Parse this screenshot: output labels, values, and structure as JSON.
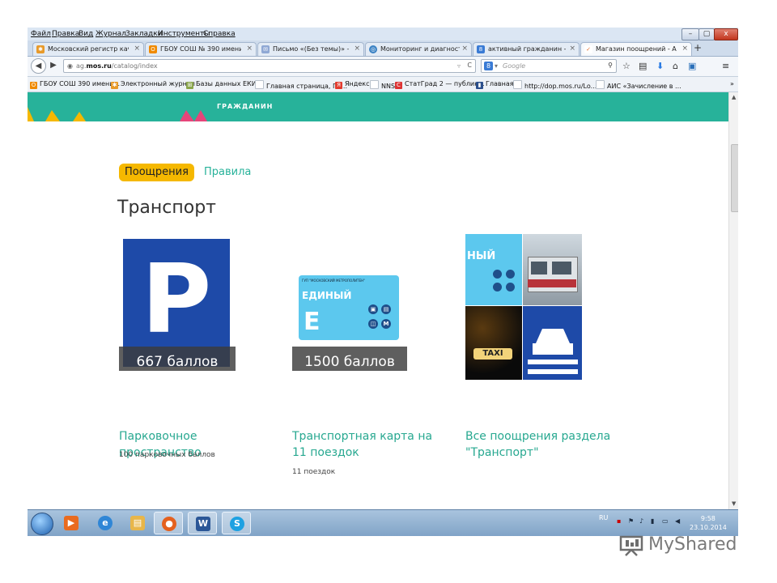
{
  "menu": [
    "Файл",
    "Правка",
    "Вид",
    "Журнал",
    "Закладки",
    "Инструменты",
    "Справка"
  ],
  "window_controls": {
    "minimize": "–",
    "maximize": "▢",
    "close": "x"
  },
  "tabs": [
    {
      "label": "Московский регистр каче...",
      "icon": "leaf-icon",
      "color": "#e89a2a"
    },
    {
      "label": "ГБОУ СОШ № 390 имени ...",
      "icon": "orange-o-icon",
      "color": "#f08a00"
    },
    {
      "label": "Письмо «(Без темы)» — Е...",
      "icon": "mail-icon",
      "color": "#6a8fc9"
    },
    {
      "label": "Мониторинг и диагностика",
      "icon": "globe-icon",
      "color": "#3b82c4"
    },
    {
      "label": "активный гражданин - По...",
      "icon": "google-icon",
      "color": "#3a7bd5"
    },
    {
      "label": "Магазин поощрений - Ак...",
      "icon": "ag-icon",
      "color": "#e46b2a"
    }
  ],
  "tab_close": "×",
  "new_tab": "+",
  "url": {
    "prefix": "ag.",
    "host": "mos.ru",
    "path": "/catalog/index"
  },
  "search": {
    "engine_label": "8",
    "placeholder": "Google"
  },
  "bookmarks": [
    {
      "label": "ГБОУ СОШ 390 имени...",
      "color": "#f08a00",
      "glyph": "О"
    },
    {
      "label": "Электронный журнал",
      "color": "#e89a2a",
      "glyph": "✱"
    },
    {
      "label": "Базы данных ЕКИС",
      "color": "#8aa64c",
      "glyph": "⊞"
    },
    {
      "label": "Главная страница, ГБ...",
      "color": "#b9c2cc",
      "glyph": ""
    },
    {
      "label": "Яндекс",
      "color": "#e23b2e",
      "glyph": "Я"
    },
    {
      "label": "NNS",
      "color": "#b9c2cc",
      "glyph": ""
    },
    {
      "label": "СтатГрад 2 — публик...",
      "color": "#d33",
      "glyph": "С"
    },
    {
      "label": "Главная",
      "color": "#2b4f8c",
      "glyph": "▮"
    },
    {
      "label": "http://dop.mos.ru/Lo...",
      "color": "#b9c2cc",
      "glyph": ""
    },
    {
      "label": "АИС «Зачисление в ...",
      "color": "#b9c2cc",
      "glyph": ""
    }
  ],
  "bookmarks_more": "»",
  "banner": {
    "text": "ГРАЖДАНИН"
  },
  "nav": {
    "active": "Поощрения",
    "other": "Правила"
  },
  "section_title": "Транспорт",
  "cards": [
    {
      "price": "667 баллов",
      "title": "Парковочное пространство",
      "subtitle": "100 парковочных баллов"
    },
    {
      "price": "1500 баллов",
      "title": "Транспортная карта на 11 поездок",
      "subtitle": "11 поездок"
    },
    {
      "price": "",
      "title": "Все поощрения раздела \"Транспорт\"",
      "subtitle": ""
    }
  ],
  "card_images": {
    "parking_letter": "P",
    "ticket_brand": "ГУП \"МОСКОВСКИЙ МЕТРОПОЛИТЕН\"",
    "ticket_name": "ЕДИНЫЙ",
    "ticket_letter": "E",
    "collage_word": "НЫЙ",
    "taxi_word": "TAXI"
  },
  "taskbar": {
    "apps": [
      {
        "name": "media-player-icon",
        "color": "#e96b1f",
        "glyph": "▶",
        "open": false
      },
      {
        "name": "internet-explorer-icon",
        "color": "#2f86d6",
        "glyph": "e",
        "open": false
      },
      {
        "name": "file-explorer-icon",
        "color": "#e8b64a",
        "glyph": "▤",
        "open": false
      },
      {
        "name": "firefox-icon",
        "color": "#e4611f",
        "glyph": "●",
        "open": true
      },
      {
        "name": "word-icon",
        "color": "#2b5797",
        "glyph": "W",
        "open": true
      },
      {
        "name": "skype-icon",
        "color": "#1da1e2",
        "glyph": "S",
        "open": true
      }
    ],
    "lang": "RU",
    "time": "9:58",
    "date": "23.10.2014"
  },
  "watermark": {
    "text": "MyShared"
  }
}
